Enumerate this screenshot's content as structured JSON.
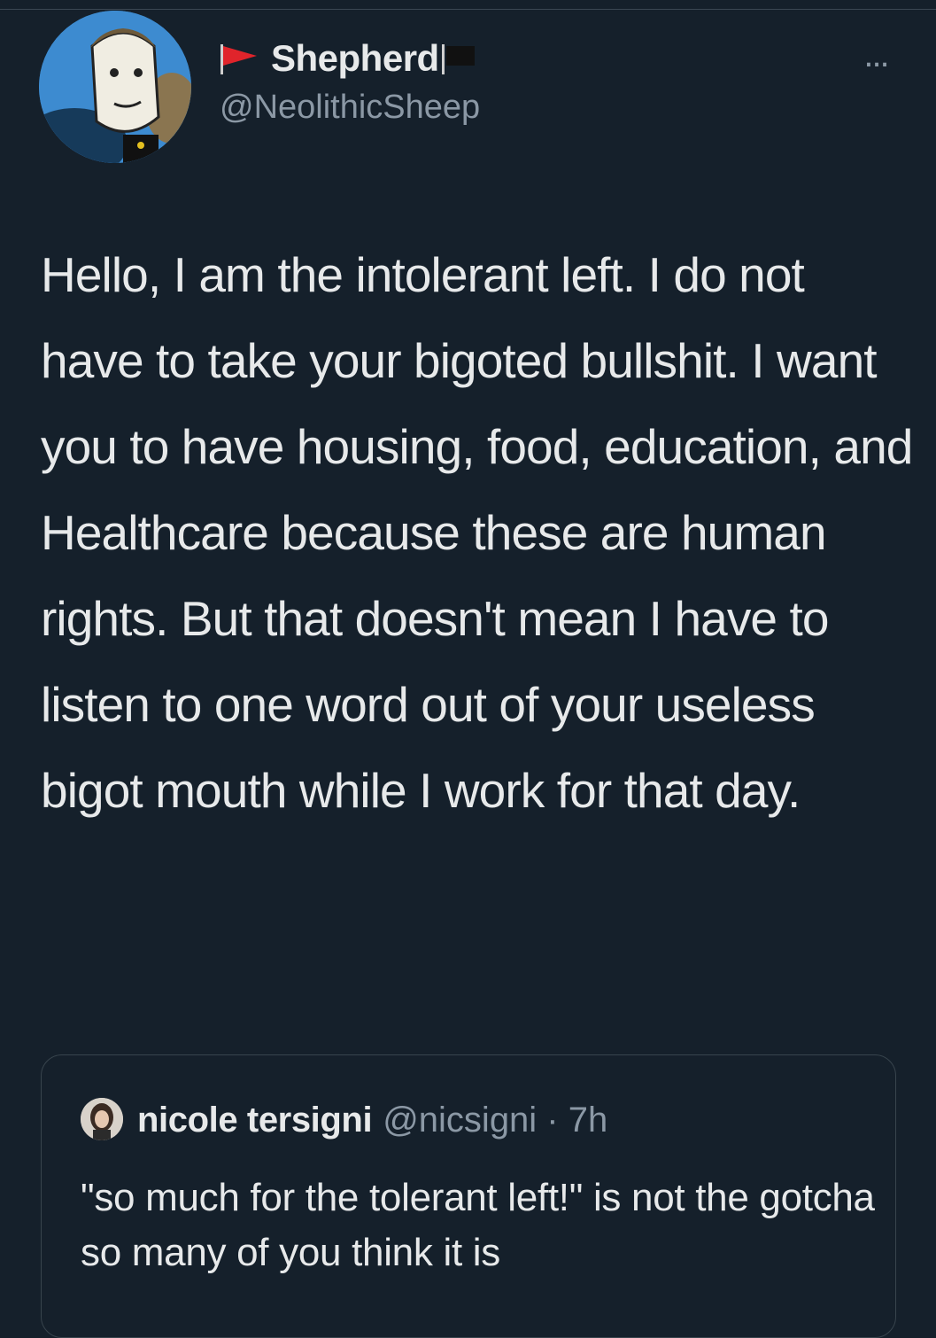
{
  "tweet": {
    "display_name": "Shepherd",
    "handle": "@NeolithicSheep",
    "more_label": "...",
    "text": "Hello, I am the intolerant left. I do not have to take your bigoted bullshit. I want you to have housing, food, education, and Healthcare because these are human rights. But that doesn't mean I have to listen to one word out of your useless bigot mouth while I work for that day.",
    "name_flags": [
      "red-flag-icon",
      "black-flag-icon"
    ]
  },
  "quoted_tweet": {
    "display_name": "nicole tersigni",
    "handle_time": "@nicsigni · 7h",
    "text": "\"so much for the tolerant left!\" is not the gotcha so many of you think it is"
  },
  "colors": {
    "background": "#15202b",
    "text_primary": "#e7e9ea",
    "text_secondary": "#8b98a5",
    "border": "#38444d",
    "red_flag": "#e0242b"
  }
}
